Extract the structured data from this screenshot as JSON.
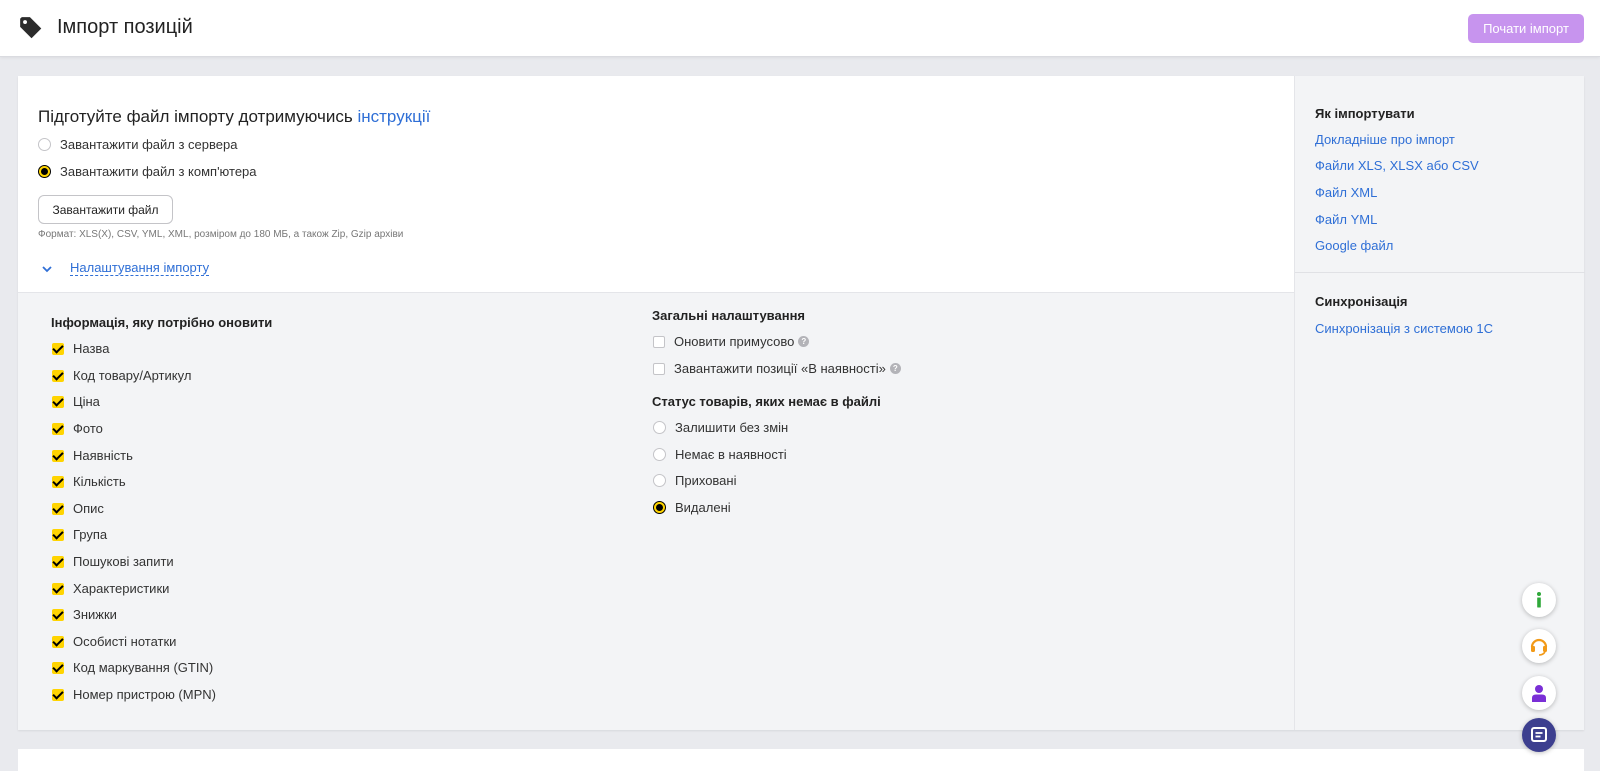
{
  "header": {
    "title": "Імпорт позицій",
    "start_button": "Почати імпорт",
    "icon": "tag-icon"
  },
  "import": {
    "heading_prefix": "Підготуйте файл імпорту дотримуючись ",
    "heading_link": "інструкції",
    "sources": [
      {
        "label": "Завантажити файл з сервера",
        "selected": false
      },
      {
        "label": "Завантажити файл з комп'ютера",
        "selected": true
      }
    ],
    "upload_button": "Завантажити файл",
    "format_note": "Формат: XLS(X), CSV, YML, XML, розміром до 180 МБ, а також Zip, Gzip архіви",
    "settings_toggle": "Налаштування імпорту"
  },
  "update_info": {
    "title": "Інформація, яку потрібно оновити",
    "items": [
      {
        "label": "Назва",
        "checked": true
      },
      {
        "label": "Код товару/Артикул",
        "checked": true
      },
      {
        "label": "Ціна",
        "checked": true
      },
      {
        "label": "Фото",
        "checked": true
      },
      {
        "label": "Наявність",
        "checked": true
      },
      {
        "label": "Кількість",
        "checked": true
      },
      {
        "label": "Опис",
        "checked": true
      },
      {
        "label": "Група",
        "checked": true
      },
      {
        "label": "Пошукові запити",
        "checked": true
      },
      {
        "label": "Характеристики",
        "checked": true
      },
      {
        "label": "Знижки",
        "checked": true
      },
      {
        "label": "Особисті нотатки",
        "checked": true
      },
      {
        "label": "Код маркування (GTIN)",
        "checked": true
      },
      {
        "label": "Номер пристрою (MPN)",
        "checked": true
      }
    ]
  },
  "general": {
    "title": "Загальні налаштування",
    "options": [
      {
        "label": "Оновити примусово",
        "checked": false
      },
      {
        "label": "Завантажити позиції «В наявності»",
        "checked": false
      }
    ],
    "help_glyph": "?"
  },
  "missing_status": {
    "title": "Статус товарів, яких немає в файлі",
    "options": [
      {
        "label": "Залишити без змін",
        "selected": false
      },
      {
        "label": "Немає в наявності",
        "selected": false
      },
      {
        "label": "Приховані",
        "selected": false
      },
      {
        "label": "Видалені",
        "selected": true
      }
    ]
  },
  "sidebar": {
    "how_title": "Як імпортувати",
    "how_links": [
      "Докладніше про імпорт",
      "Файли XLS, XLSX або CSV",
      "Файл XML",
      "Файл YML",
      "Google файл"
    ],
    "sync_title": "Синхронізація",
    "sync_links": [
      "Синхронізація з системою 1С"
    ]
  },
  "floating_buttons": [
    {
      "name": "info-icon",
      "color": "#2fa83a"
    },
    {
      "name": "headset-icon",
      "color": "#f29a18"
    },
    {
      "name": "user-icon",
      "color": "#7a2fd6"
    },
    {
      "name": "chat-icon",
      "color": "#3d3f8f"
    }
  ],
  "colors": {
    "accent_yellow": "#ffd400",
    "link_blue": "#2f6fd6",
    "start_button_bg": "#c794ee"
  }
}
